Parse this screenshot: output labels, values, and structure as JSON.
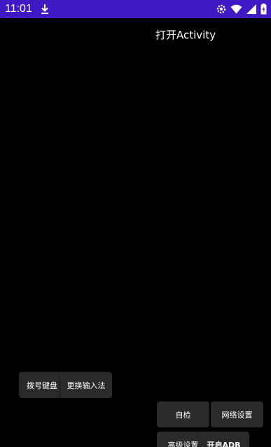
{
  "status_bar": {
    "time": "11:01",
    "background": "#3f1ac4",
    "icons": [
      "download-icon",
      "settings-icon",
      "wifi-icon",
      "signal-icon",
      "battery-charging-icon"
    ]
  },
  "main": {
    "open_activity_label": "打开Activity"
  },
  "buttons": {
    "dial_pad": "拨号键盘",
    "switch_ime": "更换输入法",
    "self_check": "自检",
    "network_settings": "网络设置",
    "advanced_settings": "高级设置",
    "enable_adb": "开启ADB"
  }
}
